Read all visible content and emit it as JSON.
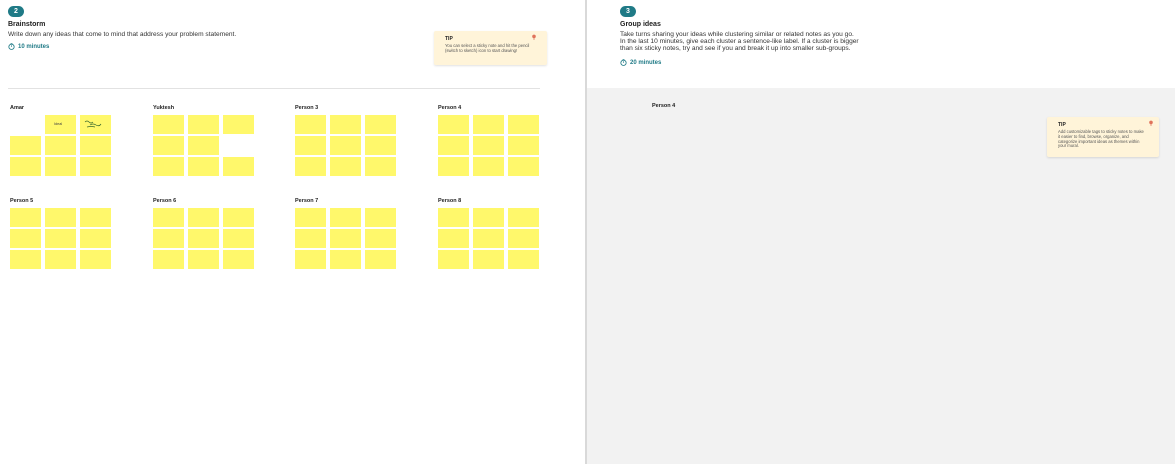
{
  "brainstorm": {
    "step_number": "2",
    "title": "Brainstorm",
    "description": "Write down any ideas that come to mind that address your problem statement.",
    "timer": "10 minutes",
    "tip": {
      "label": "TIP",
      "text": "You can select a sticky note and hit the pencil (switch to sketch) icon to start drawing!"
    },
    "people": [
      {
        "name": "Amar",
        "notes": [
          "",
          "Ideal",
          "scribble",
          "",
          "",
          "",
          "",
          "",
          ""
        ],
        "empty": [
          0
        ]
      },
      {
        "name": "Yuktesh",
        "notes": [
          "",
          "",
          "",
          "",
          "",
          "",
          "",
          "",
          ""
        ],
        "empty": [
          5
        ]
      },
      {
        "name": "Person 3",
        "notes": [
          "",
          "",
          "",
          "",
          "",
          "",
          "",
          "",
          ""
        ],
        "empty": []
      },
      {
        "name": "Person 4",
        "notes": [
          "",
          "",
          "",
          "",
          "",
          "",
          "",
          "",
          ""
        ],
        "empty": []
      },
      {
        "name": "Person 5",
        "notes": [
          "",
          "",
          "",
          "",
          "",
          "",
          "",
          "",
          ""
        ],
        "empty": []
      },
      {
        "name": "Person 6",
        "notes": [
          "",
          "",
          "",
          "",
          "",
          "",
          "",
          "",
          ""
        ],
        "empty": []
      },
      {
        "name": "Person 7",
        "notes": [
          "",
          "",
          "",
          "",
          "",
          "",
          "",
          "",
          ""
        ],
        "empty": []
      },
      {
        "name": "Person 8",
        "notes": [
          "",
          "",
          "",
          "",
          "",
          "",
          "",
          "",
          ""
        ],
        "empty": []
      }
    ]
  },
  "group_ideas": {
    "step_number": "3",
    "title": "Group ideas",
    "description_lines": [
      "Take turns sharing your ideas while clustering similar or related notes as you go.",
      "In the last 10 minutes, give each cluster a sentence-like label. If a cluster is bigger",
      "than six sticky notes, try and see if you and break it up into smaller sub-groups."
    ],
    "timer": "20 minutes",
    "canvas_label": "Person 4",
    "tip": {
      "label": "TIP",
      "text": "Add customizable tags to sticky notes to make it easier to find, browse, organize, and categorize important ideas as themes within your mural."
    }
  },
  "colors": {
    "accent": "#1f7a86",
    "sticky": "#fff86b",
    "tip_background": "#fff4d9",
    "canvas_gray": "#f2f2f2"
  }
}
